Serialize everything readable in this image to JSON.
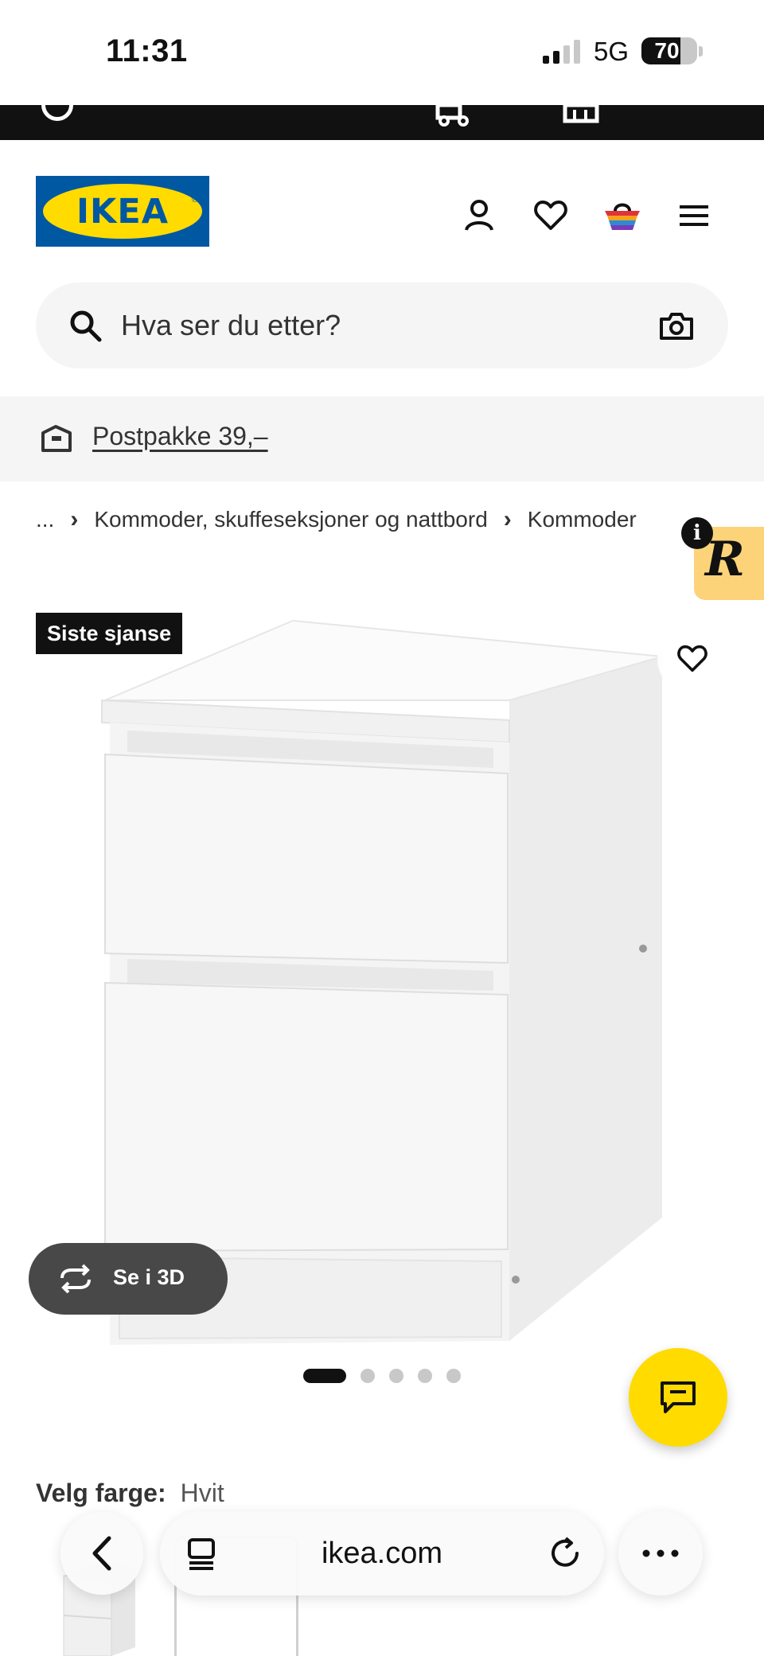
{
  "status_bar": {
    "time": "11:31",
    "network": "5G",
    "battery": "70",
    "battery_level": 0.7
  },
  "header": {
    "logo_text": "IKEA",
    "icons": [
      "account-icon",
      "wishlist-heart-icon",
      "shopping-bag-icon",
      "menu-icon"
    ],
    "search": {
      "placeholder": "Hva ser du etter?"
    }
  },
  "delivery": {
    "label": "Postpakke 39,–"
  },
  "breadcrumb": {
    "ellipsis": "...",
    "items": [
      "Kommoder, skuffeseksjoner og nattbord",
      "Kommoder"
    ]
  },
  "floating_tag": {
    "letter": "R",
    "info": "i"
  },
  "product": {
    "badge": "Siste sjanse",
    "view_3d": "Se i 3D",
    "image_count": 5,
    "active_image": 1
  },
  "color_selector": {
    "label": "Velg farge:",
    "value": "Hvit"
  },
  "browser": {
    "domain": "ikea.com"
  },
  "colors": {
    "ikea_blue": "#0058a3",
    "ikea_yellow": "#ffdb00",
    "badge_black": "#111111"
  }
}
